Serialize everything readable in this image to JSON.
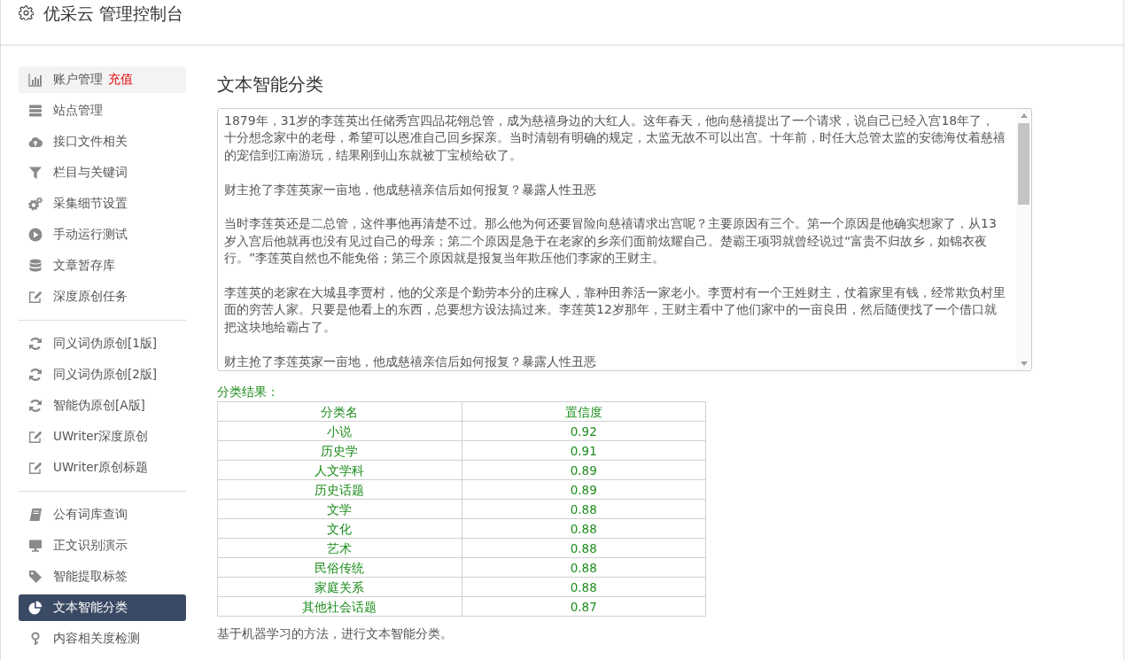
{
  "header": {
    "title": "优采云 管理控制台"
  },
  "sidebar": {
    "groups": [
      {
        "items": [
          {
            "label": "账户管理",
            "badge": "充值",
            "selected": false,
            "highlighted": true
          },
          {
            "label": "站点管理",
            "selected": false,
            "highlighted": false
          },
          {
            "label": "接口文件相关",
            "selected": false,
            "highlighted": false
          },
          {
            "label": "栏目与关键词",
            "selected": false,
            "highlighted": false
          },
          {
            "label": "采集细节设置",
            "selected": false,
            "highlighted": false
          },
          {
            "label": "手动运行测试",
            "selected": false,
            "highlighted": false
          },
          {
            "label": "文章暂存库",
            "selected": false,
            "highlighted": false
          },
          {
            "label": "深度原创任务",
            "selected": false,
            "highlighted": false
          }
        ]
      },
      {
        "items": [
          {
            "label": "同义词伪原创[1版]",
            "selected": false,
            "highlighted": false
          },
          {
            "label": "同义词伪原创[2版]",
            "selected": false,
            "highlighted": false
          },
          {
            "label": "智能伪原创[A版]",
            "selected": false,
            "highlighted": false
          },
          {
            "label": "UWriter深度原创",
            "selected": false,
            "highlighted": false
          },
          {
            "label": "UWriter原创标题",
            "selected": false,
            "highlighted": false
          }
        ]
      },
      {
        "items": [
          {
            "label": "公有词库查询",
            "selected": false,
            "highlighted": false
          },
          {
            "label": "正文识别演示",
            "selected": false,
            "highlighted": false
          },
          {
            "label": "智能提取标签",
            "selected": false,
            "highlighted": false
          },
          {
            "label": "文本智能分类",
            "selected": true,
            "highlighted": false
          },
          {
            "label": "内容相关度检测",
            "selected": false,
            "highlighted": false
          }
        ]
      }
    ]
  },
  "main": {
    "title": "文本智能分类",
    "text_area": {
      "paragraphs": [
        "1879年，31岁的李莲英出任储秀宫四品花翎总管，成为慈禧身边的大红人。这年春天，他向慈禧提出了一个请求，说自己已经入宫18年了，十分想念家中的老母，希望可以恩准自己回乡探亲。当时清朝有明确的规定，太监无故不可以出宫。十年前，时任大总管太监的安德海仗着慈禧的宠信到江南游玩，结果刚到山东就被丁宝桢给砍了。",
        "财主抢了李莲英家一亩地，他成慈禧亲信后如何报复？暴露人性丑恶",
        "当时李莲英还是二总管，这件事他再清楚不过。那么他为何还要冒险向慈禧请求出宫呢？主要原因有三个。第一个原因是他确实想家了，从13岁入宫后他就再也没有见过自己的母亲；第二个原因是急于在老家的乡亲们面前炫耀自己。楚霸王项羽就曾经说过“富贵不归故乡，如锦衣夜行。”李莲英自然也不能免俗；第三个原因就是报复当年欺压他们李家的王财主。",
        "李莲英的老家在大城县李贾村，他的父亲是个勤劳本分的庄稼人，靠种田养活一家老小。李贾村有一个王姓财主，仗着家里有钱，经常欺负村里面的穷苦人家。只要是他看上的东西，总要想方设法搞过来。李莲英12岁那年，王财主看中了他们家中的一亩良田，然后随便找了一个借口就把这块地给霸占了。",
        "财主抢了李莲英家一亩地，他成慈禧亲信后如何报复？暴露人性丑恶"
      ]
    },
    "result_label": "分类结果：",
    "table": {
      "columns": [
        "分类名",
        "置信度"
      ],
      "rows": [
        [
          "小说",
          "0.92"
        ],
        [
          "历史学",
          "0.91"
        ],
        [
          "人文学科",
          "0.89"
        ],
        [
          "历史话题",
          "0.89"
        ],
        [
          "文学",
          "0.88"
        ],
        [
          "文化",
          "0.88"
        ],
        [
          "艺术",
          "0.88"
        ],
        [
          "民俗传统",
          "0.88"
        ],
        [
          "家庭关系",
          "0.88"
        ],
        [
          "其他社会话题",
          "0.87"
        ]
      ]
    },
    "note": "基于机器学习的方法，进行文本智能分类。"
  }
}
